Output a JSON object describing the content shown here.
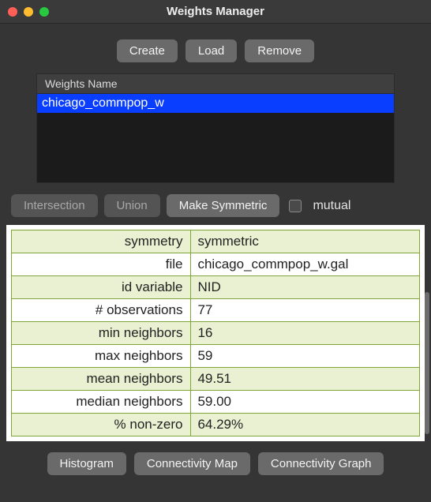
{
  "window": {
    "title": "Weights Manager"
  },
  "toolbar": {
    "create": "Create",
    "load": "Load",
    "remove": "Remove"
  },
  "list": {
    "header": "Weights Name",
    "rows": [
      "chicago_commpop_w"
    ],
    "selected_index": 0
  },
  "ops": {
    "intersection": "Intersection",
    "union": "Union",
    "make_symmetric": "Make Symmetric",
    "mutual": "mutual",
    "mutual_checked": false
  },
  "properties": [
    {
      "key": "symmetry",
      "value": "symmetric"
    },
    {
      "key": "file",
      "value": "chicago_commpop_w.gal"
    },
    {
      "key": "id variable",
      "value": "NID"
    },
    {
      "key": "# observations",
      "value": "77"
    },
    {
      "key": "min neighbors",
      "value": "16"
    },
    {
      "key": "max neighbors",
      "value": "59"
    },
    {
      "key": "mean neighbors",
      "value": "49.51"
    },
    {
      "key": "median neighbors",
      "value": "59.00"
    },
    {
      "key": "% non-zero",
      "value": "64.29%"
    }
  ],
  "bottom": {
    "histogram": "Histogram",
    "conn_map": "Connectivity Map",
    "conn_graph": "Connectivity Graph"
  }
}
